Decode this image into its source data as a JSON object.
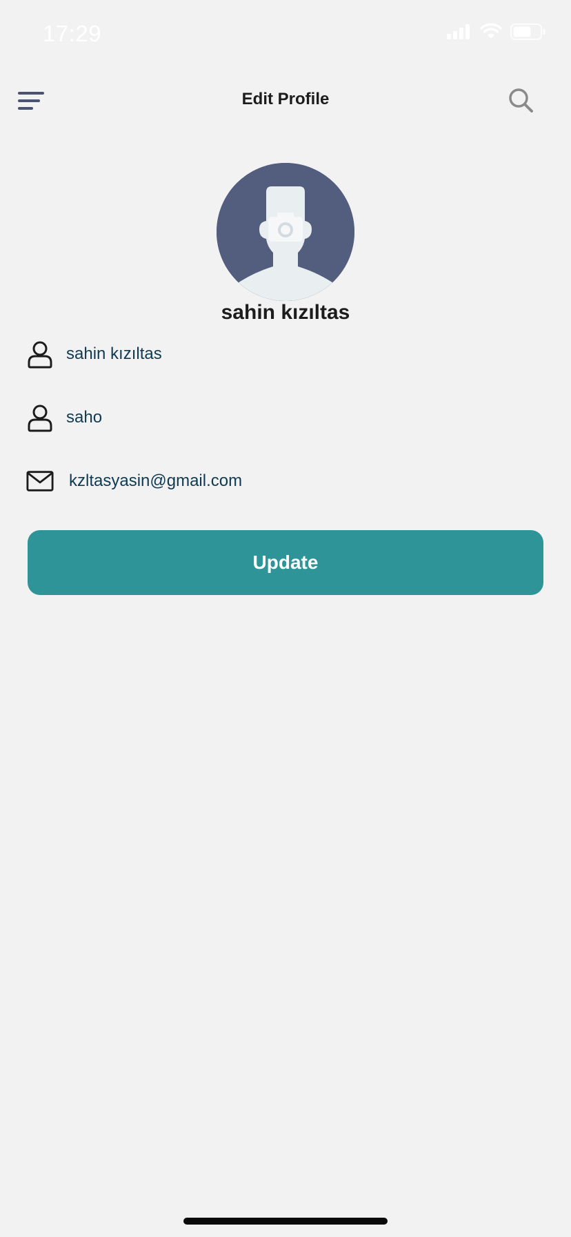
{
  "status_bar": {
    "time": "17:29",
    "icons": [
      "cellular-signal-icon",
      "wifi-icon",
      "battery-icon"
    ]
  },
  "nav": {
    "title": "Edit Profile",
    "menu_icon": "hamburger-menu-icon",
    "search_icon": "search-icon"
  },
  "profile": {
    "display_name": "sahin kızıltas",
    "avatar_icon": "camera-icon"
  },
  "fields": [
    {
      "icon": "user-icon",
      "value": "sahin kızıltas"
    },
    {
      "icon": "user-icon",
      "value": "saho"
    },
    {
      "icon": "mail-icon",
      "value": "kzltasyasin@gmail.com"
    }
  ],
  "actions": {
    "update_label": "Update"
  },
  "colors": {
    "background": "#f2f2f2",
    "accent": "#2e9497",
    "avatar_bg": "#535e7e",
    "field_text": "#0f3a52",
    "title_text": "#1c1c1c"
  }
}
